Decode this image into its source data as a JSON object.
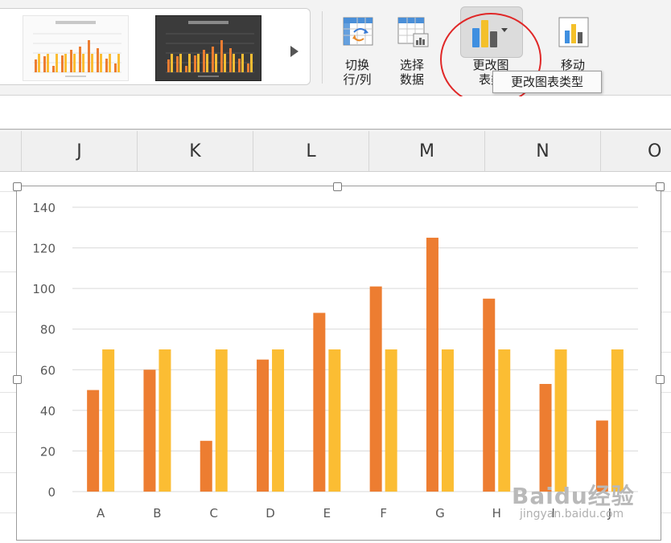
{
  "ribbon": {
    "buttons": [
      {
        "id": "switch-row-col",
        "label": "切换\n行/列",
        "icon": "switch-row-col-icon"
      },
      {
        "id": "select-data",
        "label": "选择\n数据",
        "icon": "select-data-icon"
      },
      {
        "id": "change-chart-type",
        "label": "更改图\n表类",
        "icon": "change-chart-type-icon"
      },
      {
        "id": "move-chart",
        "label": "移动",
        "icon": "move-chart-icon"
      }
    ],
    "tooltip": "更改图表类型"
  },
  "columns": [
    "J",
    "K",
    "L",
    "M",
    "N",
    "O"
  ],
  "chart_data": {
    "type": "bar",
    "categories": [
      "A",
      "B",
      "C",
      "D",
      "E",
      "F",
      "G",
      "H",
      "I",
      "J"
    ],
    "series": [
      {
        "values": [
          50,
          60,
          25,
          65,
          88,
          101,
          125,
          95,
          53,
          35
        ],
        "color": "#ed7d31"
      },
      {
        "values": [
          70,
          70,
          70,
          70,
          70,
          70,
          70,
          70,
          70,
          70
        ],
        "color": "#fbbd33"
      }
    ],
    "ylim": [
      0,
      140
    ],
    "yticks": [
      0,
      20,
      40,
      60,
      80,
      100,
      120,
      140
    ],
    "grid": true,
    "xlabel": "",
    "ylabel": "",
    "title": ""
  },
  "watermark": {
    "main": "Baidu经验",
    "sub": "jingyan.baidu.com"
  },
  "colors": {
    "accent_circle": "#e02828",
    "bar_orange": "#ed7d31",
    "bar_yellow": "#fbbd33"
  }
}
